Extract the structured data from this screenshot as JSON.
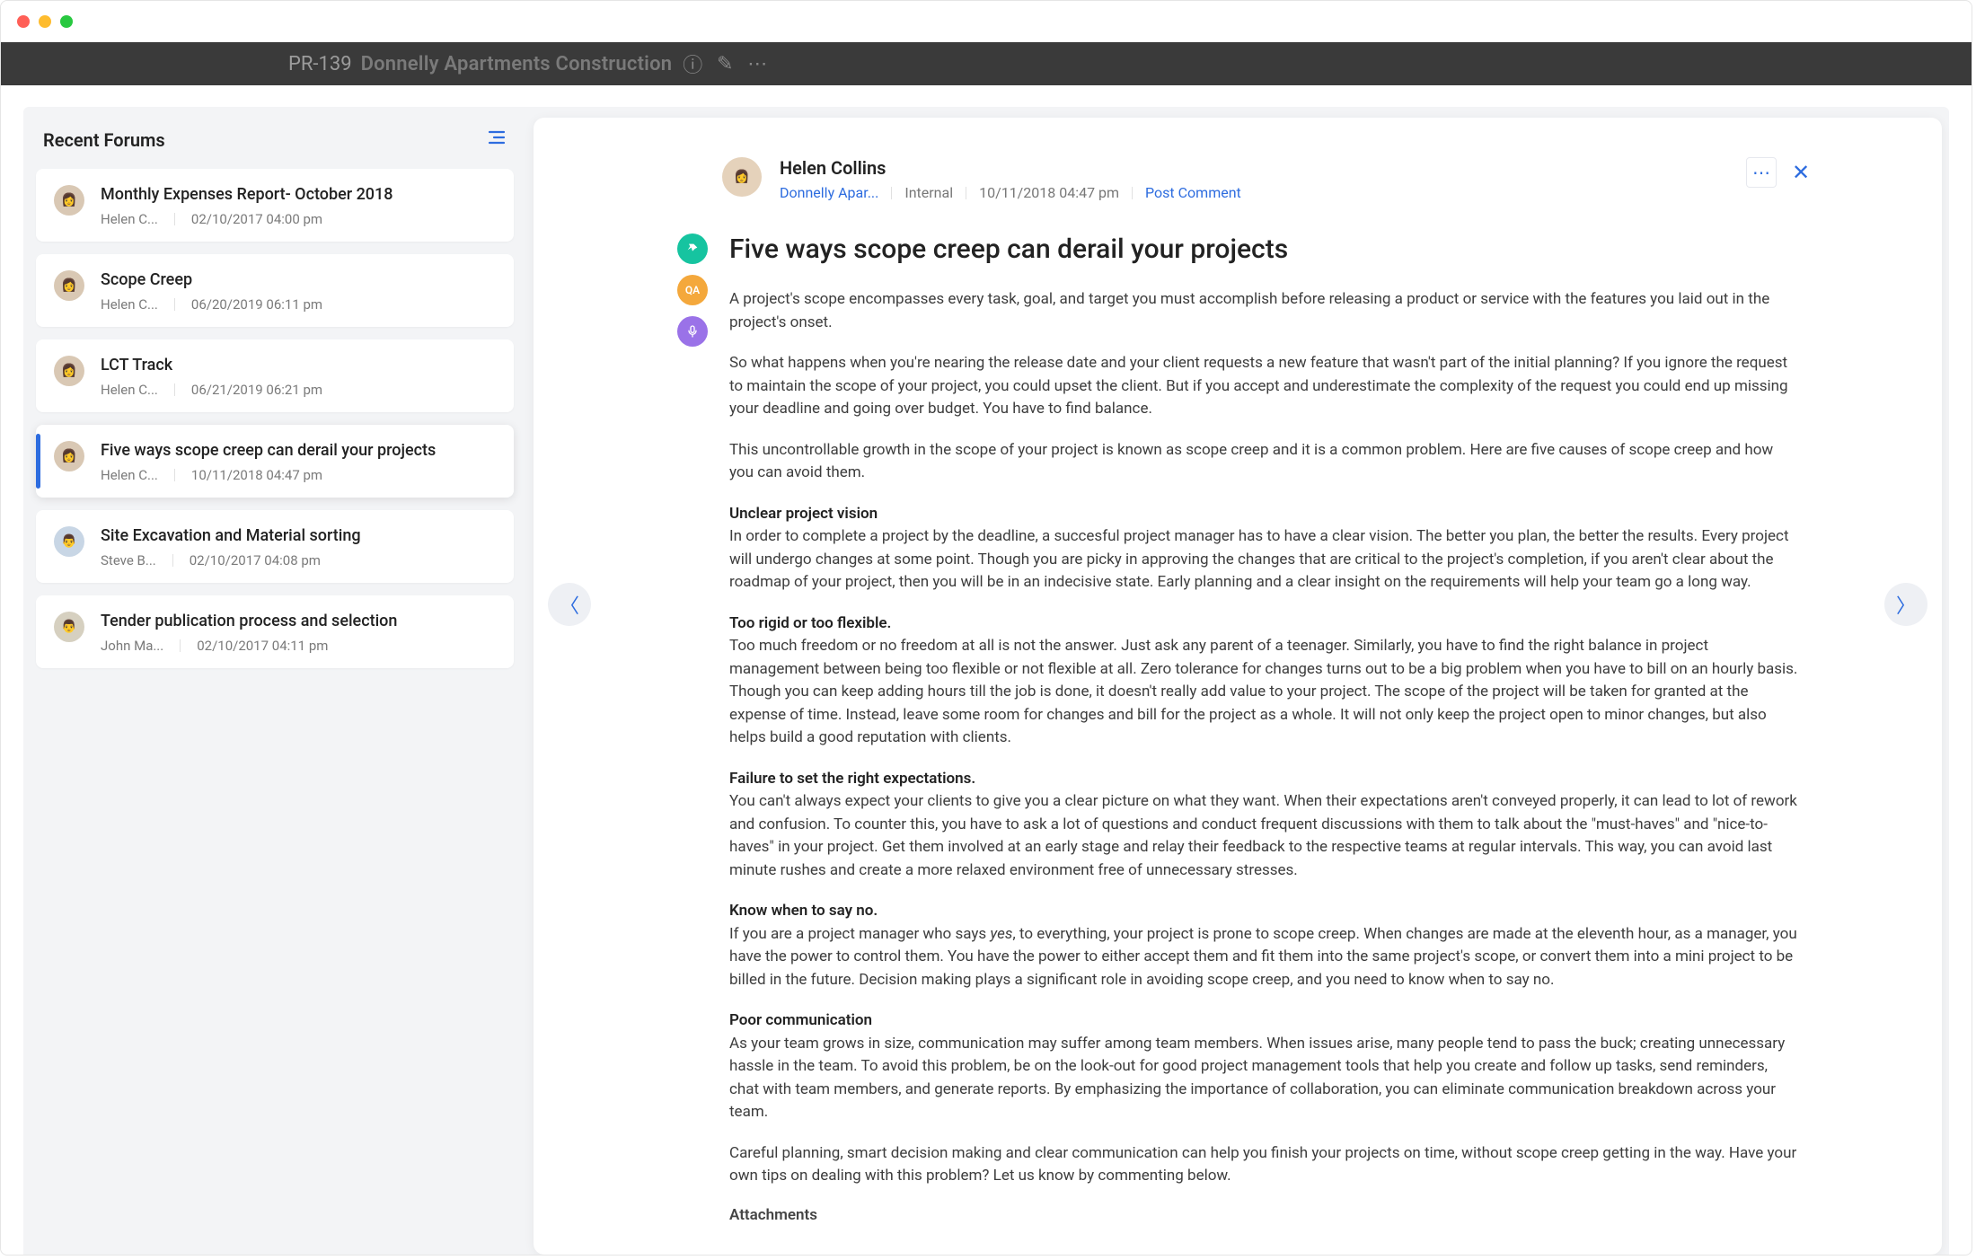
{
  "topbar": {
    "project_id": "PR-139",
    "project_name": "Donnelly Apartments Construction"
  },
  "sidebar": {
    "title": "Recent Forums",
    "items": [
      {
        "title": "Monthly Expenses Report- October 2018",
        "author": "Helen C...",
        "timestamp": "02/10/2017 04:00 pm",
        "active": false
      },
      {
        "title": "Scope Creep",
        "author": "Helen C...",
        "timestamp": "06/20/2019 06:11 pm",
        "active": false
      },
      {
        "title": "LCT Track",
        "author": "Helen C...",
        "timestamp": "06/21/2019 06:21 pm",
        "active": false
      },
      {
        "title": "Five ways scope creep can derail your projects",
        "author": "Helen C...",
        "timestamp": "10/11/2018 04:47 pm",
        "active": true
      },
      {
        "title": "Site Excavation and Material sorting",
        "author": "Steve B...",
        "timestamp": "02/10/2017 04:08 pm",
        "active": false
      },
      {
        "title": "Tender publication process and selection",
        "author": "John Ma...",
        "timestamp": "02/10/2017 04:11 pm",
        "active": false
      }
    ]
  },
  "post": {
    "author": "Helen Collins",
    "project_link": "Donnelly Apar...",
    "visibility": "Internal",
    "timestamp": "10/11/2018 04:47 pm",
    "comment_action": "Post Comment",
    "title": "Five ways scope creep can derail your projects",
    "badges": {
      "qa_label": "QA"
    },
    "p_intro1": "A project's scope encompasses every task, goal, and target you must accomplish before releasing a product or service with the features you laid out in the project's onset.",
    "p_intro2": "So what happens when you're nearing the release date and your client requests a new feature that wasn't part of the initial planning? If you ignore the request to maintain the scope of your project, you could upset the client. But if you accept and underestimate the complexity of the request you could end up missing your deadline and going over budget. You have to find balance.",
    "p_intro3": "This uncontrollable growth in the scope of your project is known as scope creep and it is a common problem. Here are five causes of scope creep and how you can avoid them.",
    "h1": "Unclear project vision",
    "p1": "In order to complete a project by the deadline, a succesful project manager has to have a clear vision. The better you plan, the better the results. Every project will undergo changes at some point. Though you are picky in approving the changes that are critical to the project's completion, if you aren't clear about the roadmap of your project, then you will be in an indecisive state. Early planning and a clear insight on the requirements will help your team go a long way.",
    "h2": "Too rigid or too flexible.",
    "p2": "Too much freedom or no freedom at all is not the answer. Just ask any parent of a teenager. Similarly, you have to find the right balance in project management between being too flexible or not flexible at all. Zero tolerance for changes turns out to be a big problem when you have to bill on an hourly basis. Though you can keep adding hours till the job is done, it doesn't really add value to your project. The scope of the project will be taken for granted at the expense of time. Instead, leave some room for changes and bill for the project as a whole. It will not only keep the project open to minor changes, but also helps build a good reputation with clients.",
    "h3": "Failure to set the right expectations.",
    "p3": "You can't always expect your clients to give you a clear picture on what they want. When their expectations aren't conveyed properly, it can lead to lot of rework and confusion. To counter this, you have to ask a lot of questions and conduct frequent discussions with them to talk about the \"must-haves\" and \"nice-to-haves\" in your project. Get them involved at an early stage and relay their feedback to the respective teams at regular intervals. This way, you can avoid last minute rushes and create a more relaxed environment free of unnecessary stresses.",
    "h4": "Know when to say no.",
    "p4a": "If you are a project manager who says ",
    "p4yes": "yes",
    "p4b": ", to everything, your project is prone to scope creep. When changes are made at the eleventh hour, as a manager, you have the power to control them. You have the power to either accept them and fit them into the same project's scope, or convert them into a mini project to be billed in the future. Decision making plays a significant role in avoiding scope creep, and you need to know when to say no.",
    "h5": "Poor communication",
    "p5": "As your team grows in size, communication may suffer among team members. When issues arise, many people tend to pass the buck; creating unnecessary hassle in the team. To avoid this problem, be on the look-out for good project management tools that help you create and follow up tasks, send reminders, chat with team members, and generate reports. By emphasizing the importance of collaboration, you can eliminate communication breakdown across your team.",
    "p_outro": "Careful planning, smart decision making and clear communication can help you finish your projects on time, without scope creep getting in the way. Have your own tips on dealing with this problem? Let us know by commenting below.",
    "attachments_label": "Attachments"
  }
}
